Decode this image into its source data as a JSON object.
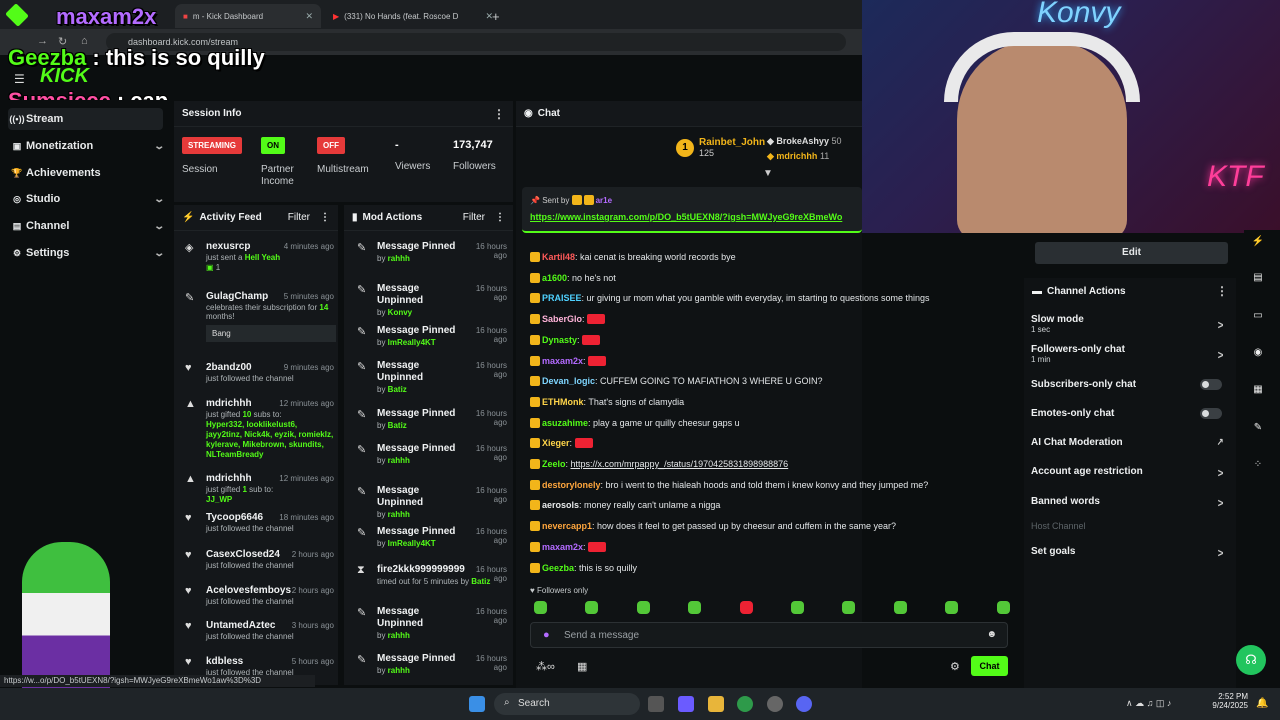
{
  "browser": {
    "tabs": [
      {
        "title": "m - Kick Dashboard"
      },
      {
        "title": "(331) No Hands (feat. Roscoe D"
      }
    ],
    "url": "dashboard.kick.com/stream",
    "status_url": "https://w...o/p/DO_b5tUEXN8/?igsh=MWJyeG9reXBmeWo1aw%3D%3D"
  },
  "overlay": {
    "streamer": "maxam2x",
    "line1_user": "Geezba",
    "line1_text": "this is so quilly",
    "line2_user": "Sumsiccc",
    "line2_text": "cap",
    "webcam_label": "Konvy"
  },
  "logo": "KICK",
  "sidebar": {
    "items": [
      {
        "label": "Stream"
      },
      {
        "label": "Monetization"
      },
      {
        "label": "Achievements"
      },
      {
        "label": "Studio"
      },
      {
        "label": "Channel"
      },
      {
        "label": "Settings"
      }
    ]
  },
  "session": {
    "title": "Session Info",
    "streaming": "STREAMING",
    "session_label": "Session",
    "on": "ON",
    "partner": "Partner Income",
    "off": "OFF",
    "multistream": "Multistream",
    "viewers_value": "-",
    "viewers": "Viewers",
    "followers_value": "173,747",
    "followers": "Followers"
  },
  "activity": {
    "title": "Activity Feed",
    "filter": "Filter",
    "items": [
      {
        "name": "nexusrcp",
        "time": "4 minutes ago",
        "sub": "just sent a",
        "extra": "Hell Yeah",
        "count": "1"
      },
      {
        "name": "GulagChamp",
        "time": "5 minutes ago",
        "sub": "celebrates their subscription for",
        "months": "14",
        "months_suffix": "months!",
        "msg": "Bang"
      },
      {
        "name": "2bandz00",
        "time": "9 minutes ago",
        "sub": "just followed the channel"
      },
      {
        "name": "mdrichhh",
        "time": "12 minutes ago",
        "sub": "just gifted",
        "gift": "10",
        "gift_suffix": "subs to:",
        "list": "Hyper332, looklikelust6, jayy2tinz, Nick4k, eyzik, romieklz, kylerave, Mikebrown, skundits, NLTeamBready"
      },
      {
        "name": "mdrichhh",
        "time": "12 minutes ago",
        "sub": "just gifted",
        "gift": "1",
        "gift_suffix": "sub to:",
        "list": "JJ_WP"
      },
      {
        "name": "Tycoop6646",
        "time": "18 minutes ago",
        "sub": "just followed the channel"
      },
      {
        "name": "CasexClosed24",
        "time": "2 hours ago",
        "sub": "just followed the channel"
      },
      {
        "name": "Acelovesfemboys",
        "time": "2 hours ago",
        "sub": "just followed the channel"
      },
      {
        "name": "UntamedAztec",
        "time": "3 hours ago",
        "sub": "just followed the channel"
      },
      {
        "name": "kdbless",
        "time": "5 hours ago",
        "sub": "just followed the channel"
      }
    ]
  },
  "mod": {
    "title": "Mod Actions",
    "filter": "Filter",
    "items": [
      {
        "action": "Message Pinned",
        "time": "16 hours ago",
        "by": "rahhh"
      },
      {
        "action": "Message Unpinned",
        "time": "16 hours ago",
        "by": "Konvy"
      },
      {
        "action": "Message Pinned",
        "time": "16 hours ago",
        "by": "ImReally4KT"
      },
      {
        "action": "Message Unpinned",
        "time": "16 hours ago",
        "by": "Batiz"
      },
      {
        "action": "Message Pinned",
        "time": "16 hours ago",
        "by": "Batiz"
      },
      {
        "action": "Message Pinned",
        "time": "16 hours ago",
        "by": "rahhh"
      },
      {
        "action": "Message Unpinned",
        "time": "16 hours ago",
        "by": "rahhh"
      },
      {
        "action": "Message Pinned",
        "time": "16 hours ago",
        "by": "ImReally4KT"
      },
      {
        "action": "fire2kkk999999999",
        "time": "16 hours ago",
        "by": "Batiz",
        "note": "timed out for 5 minutes by"
      },
      {
        "action": "Message Unpinned",
        "time": "16 hours ago",
        "by": "rahhh"
      },
      {
        "action": "Message Pinned",
        "time": "16 hours ago",
        "by": "rahhh"
      }
    ]
  },
  "chat": {
    "title": "Chat",
    "top": [
      {
        "name": "Rainbet_John",
        "count": "125"
      },
      {
        "name": "BrokeAshyy",
        "count": "50"
      },
      {
        "name": "mdrichhh",
        "count": "11"
      }
    ],
    "pinned_by_label": "Sent by",
    "pinned_by": "ar1e",
    "pinned_link": "https://www.instagram.com/p/DO_b5tUEXN8/?igsh=MWJyeG9reXBmeWo",
    "messages": [
      {
        "user": "Kartil48",
        "color": "#ff5a5a",
        "text": "kai cenat is breaking world records bye"
      },
      {
        "user": "a1600",
        "color": "#53fc18",
        "text": "no he's not"
      },
      {
        "user": "PRAISEE",
        "color": "#4fd1ff",
        "text": "ur giving ur mom what you gamble with everyday, im starting to questions some things"
      },
      {
        "user": "SaberGlo",
        "color": "#ffb3d9",
        "text": ""
      },
      {
        "user": "Dynasty",
        "color": "#53fc18",
        "text": ""
      },
      {
        "user": "maxam2x",
        "color": "#b36bff",
        "text": ""
      },
      {
        "user": "Devan_logic",
        "color": "#7fd6ff",
        "text": "CUFFEM GOING TO MAFIATHON 3 WHERE U GOIN?"
      },
      {
        "user": "ETHMonk",
        "color": "#ffd54a",
        "text": "That's signs of clamydia"
      },
      {
        "user": "asuzahime",
        "color": "#53fc18",
        "text": "play a game ur quilly cheesur gaps u"
      },
      {
        "user": "Xieger",
        "color": "#ffd54a",
        "text": ""
      },
      {
        "user": "Zeelo",
        "color": "#53fc18",
        "text": "https://x.com/mrpappy_/status/1970425831898988876"
      },
      {
        "user": "destorylonely",
        "color": "#ffa63d",
        "text": "bro i went to the hialeah hoods and told them i knew konvy and they jumped me?"
      },
      {
        "user": "aerosols",
        "color": "#e6e9ea",
        "text": "money really can't unlame a nigga"
      },
      {
        "user": "nevercapp1",
        "color": "#ffa63d",
        "text": "how does it feel to get passed up by cheesur and cuffem in the same year?"
      },
      {
        "user": "maxam2x",
        "color": "#b36bff",
        "text": ""
      },
      {
        "user": "Geezba",
        "color": "#53fc18",
        "text": "this is so quilly"
      }
    ],
    "followers_only": "Followers only",
    "placeholder": "Send a message",
    "send": "Chat"
  },
  "actions": {
    "edit": "Edit",
    "title": "Channel Actions",
    "items": [
      {
        "label": "Slow mode",
        "sub": "1 sec"
      },
      {
        "label": "Followers-only chat",
        "sub": "1 min"
      },
      {
        "label": "Subscribers-only chat"
      },
      {
        "label": "Emotes-only chat"
      },
      {
        "label": "AI Chat Moderation"
      },
      {
        "label": "Account age restriction"
      },
      {
        "label": "Banned words"
      },
      {
        "label": "Host Channel"
      },
      {
        "label": "Set goals"
      }
    ]
  },
  "taskbar": {
    "search": "Search",
    "time": "2:52 PM",
    "date": "9/24/2025"
  },
  "colors": {
    "accent": "#53fc18",
    "bg": "#0b0e0f",
    "panel": "#14171a",
    "red": "#ff3b3b"
  }
}
